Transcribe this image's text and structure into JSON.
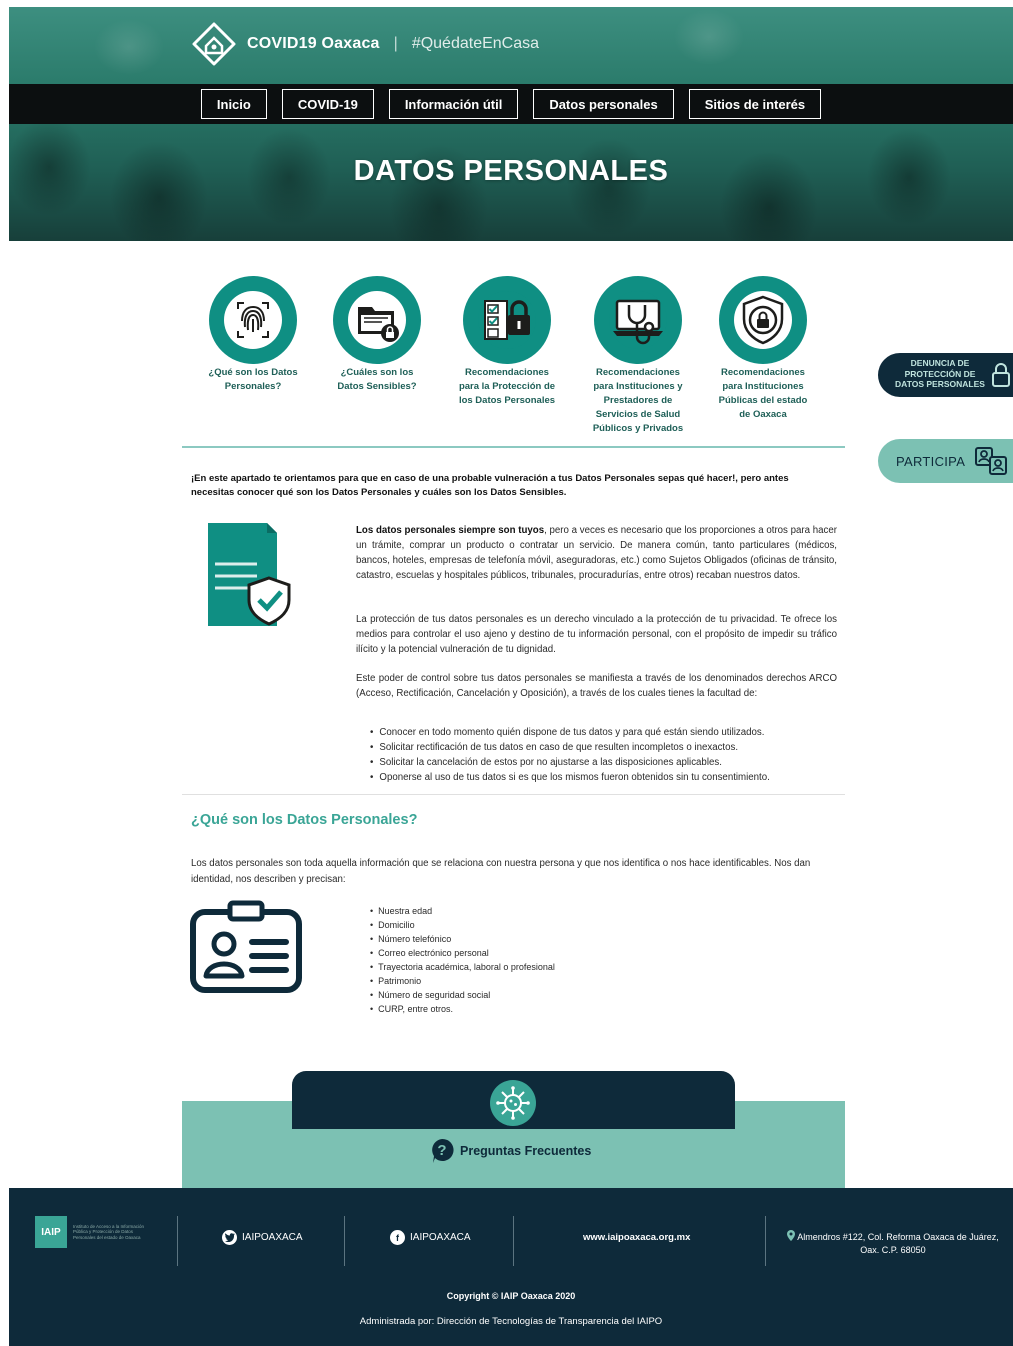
{
  "header": {
    "brand_title": "COVID19 Oaxaca",
    "separator": "|",
    "hashtag": "#QuédateEnCasa",
    "nav": [
      "Inicio",
      "COVID-19",
      "Información útil",
      "Datos personales",
      "Sitios de interés"
    ],
    "page_title": "DATOS PERSONALES"
  },
  "topics": [
    {
      "label": "¿Qué son los Datos Personales?",
      "icon": "fingerprint-icon"
    },
    {
      "label": "¿Cuáles son los Datos Sensibles?",
      "icon": "folder-lock-icon"
    },
    {
      "label": "Recomendaciones para la Protección de los Datos Personales",
      "icon": "checklist-lock-icon"
    },
    {
      "label": "Recomendaciones para Instituciones y Prestadores de Servicios de Salud Públicos y Privados",
      "icon": "stethoscope-laptop-icon"
    },
    {
      "label": "Recomendaciones para Instituciones Públicas del estado de Oaxaca",
      "icon": "shield-lock-icon"
    }
  ],
  "side": {
    "denuncia": "DENUNCIA DE PROTECCIÓN DE DATOS PERSONALES",
    "participa": "PARTICIPA"
  },
  "intro": "¡En este apartado te orientamos para que en caso de una probable vulneración a tus Datos Personales sepas qué hacer!, pero antes necesitas conocer qué son los Datos Personales y cuáles son los Datos Sensibles.",
  "content": {
    "p1_bold": "Los datos personales siempre son tuyos",
    "p1_rest": ", pero a veces es necesario que los proporciones a otros para hacer un trámite, comprar un producto o contratar un servicio. De manera común, tanto particulares (médicos, bancos, hoteles, empresas de telefonía móvil, aseguradoras, etc.) como Sujetos Obligados (oficinas de tránsito, catastro, escuelas y hospitales públicos, tribunales, procuradurías, entre otros) recaban nuestros datos.",
    "p2": "La protección de tus datos personales es un derecho vinculado a la protección de tu privacidad. Te ofrece los medios para controlar el uso ajeno y destino de tu información personal, con el propósito de impedir su tráfico ilícito y la potencial vulneración de tu dignidad.",
    "p3": "Este poder de control sobre tus datos personales se manifiesta a través de los denominados derechos ARCO (Acceso, Rectificación, Cancelación y Oposición), a través de los cuales tienes la facultad de:",
    "arco": [
      "Conocer en todo momento quién dispone de tus datos y para qué están siendo utilizados.",
      "Solicitar rectificación de tus datos en caso de que resulten incompletos o inexactos.",
      "Solicitar la cancelación de estos por no ajustarse a las disposiciones aplicables.",
      "Oponerse al uso de tus datos si es que los mismos fueron obtenidos sin tu consentimiento."
    ]
  },
  "section": {
    "title": "¿Qué son los Datos Personales?",
    "text": "Los datos personales son toda aquella información que se relaciona con nuestra persona y que nos identifica o nos hace identificables. Nos dan identidad, nos describen y precisan:",
    "items": [
      "Nuestra edad",
      "Domicilio",
      "Número telefónico",
      "Correo electrónico personal",
      "Trayectoria académica, laboral o profesional",
      "Patrimonio",
      "Número de seguridad social",
      "CURP, entre otros."
    ]
  },
  "faq": {
    "label": "Preguntas Frecuentes"
  },
  "footer": {
    "logo_abbr": "IAIP",
    "logo_text": "Instituto de Acceso a la Información Pública y Protección de Datos Personales del estado de Oaxaca",
    "twitter": "IAIPOAXACA",
    "facebook": "IAIPOAXACA",
    "website": "www.iaipoaxaca.org.mx",
    "address": "Almendros #122, Col. Reforma Oaxaca de Juárez, Oax. C.P. 68050",
    "copyright": "Copyright © IAIP Oaxaca 2020",
    "admin": "Administrada por: Dirección de Tecnologías de Transparencia del IAIPO"
  },
  "colors": {
    "teal": "#0f8f83",
    "navy": "#0e2a3a",
    "mint": "#7cc1b3",
    "title_teal": "#3aa596"
  }
}
